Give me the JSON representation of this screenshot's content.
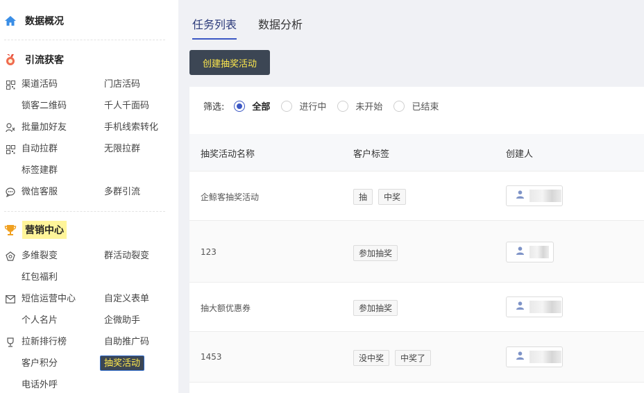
{
  "sidebar": {
    "sections": [
      {
        "label": "数据概况",
        "icon": "home-icon"
      },
      {
        "label": "引流获客",
        "icon": "medal-icon"
      },
      {
        "label": "营销中心",
        "icon": "trophy-icon"
      }
    ],
    "items": [
      "渠道活码",
      "门店活码",
      "锁客二维码",
      "千人千面码",
      "批量加好友",
      "手机线索转化",
      "自动拉群",
      "无限拉群",
      "标签建群",
      "微信客服",
      "多群引流",
      "多维裂变",
      "群活动裂变",
      "红包福利",
      "短信运营中心",
      "自定义表单",
      "个人名片",
      "企微助手",
      "拉新排行榜",
      "自助推广码",
      "客户积分",
      "抽奖活动",
      "电话外呼"
    ]
  },
  "tabs": [
    "任务列表",
    "数据分析"
  ],
  "create_button": "创建抽奖活动",
  "filter": {
    "label": "筛选:",
    "options": [
      "全部",
      "进行中",
      "未开始",
      "已结束"
    ],
    "selected": "全部"
  },
  "table": {
    "headers": [
      "抽奖活动名称",
      "客户标签",
      "创建人"
    ],
    "rows": [
      {
        "name": "企鲸客抽奖活动",
        "tags": [
          "抽",
          "中奖"
        ]
      },
      {
        "name": "123",
        "tags": [
          "参加抽奖"
        ]
      },
      {
        "name": "抽大额优惠券",
        "tags": [
          "参加抽奖"
        ]
      },
      {
        "name": "1453",
        "tags": [
          "没中奖",
          "中奖了"
        ]
      }
    ]
  },
  "colors": {
    "accent": "#3b57c4",
    "button_bg": "#3c4654",
    "button_text": "#ffe94d",
    "highlight": "#fff59a"
  }
}
